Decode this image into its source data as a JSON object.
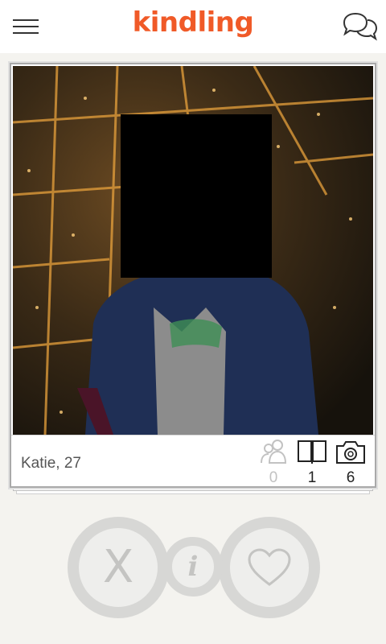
{
  "app": {
    "logo_text": "kindling",
    "brand_color": "#f05a28"
  },
  "header": {
    "menu_icon": "hamburger-menu-icon",
    "chat_icon": "chat-bubbles-icon"
  },
  "profile": {
    "name_age": "Katie, 27",
    "stats": [
      {
        "icon": "friends-icon",
        "count": "0"
      },
      {
        "icon": "book-icon",
        "count": "1"
      },
      {
        "icon": "camera-icon",
        "count": "6"
      }
    ]
  },
  "actions": {
    "reject_label": "X",
    "info_label": "i",
    "like_icon": "heart-icon"
  }
}
